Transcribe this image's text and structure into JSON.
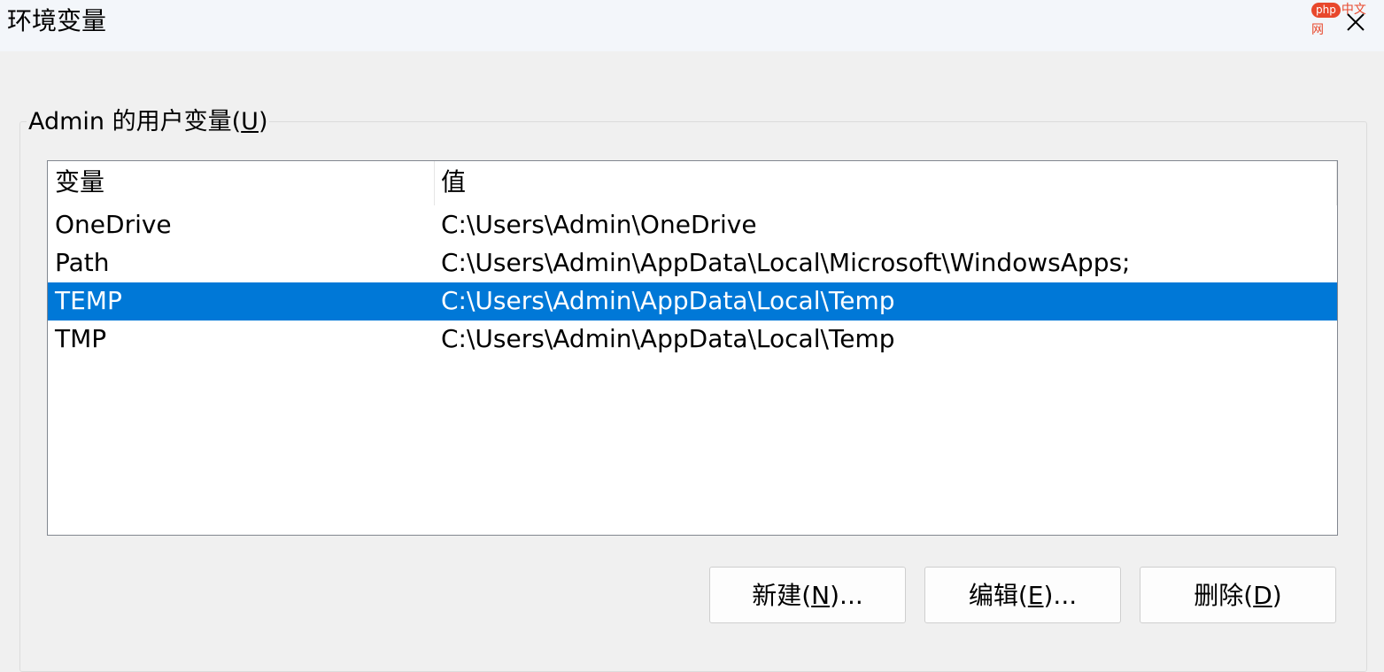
{
  "window": {
    "title": "环境变量"
  },
  "watermark": {
    "logo": "php",
    "text": "中文网"
  },
  "user_vars": {
    "group_label_prefix": "Admin 的用户变量(",
    "group_label_mnemonic": "U",
    "group_label_suffix": ")",
    "columns": [
      "变量",
      "值"
    ],
    "rows": [
      {
        "name": "OneDrive",
        "value": "C:\\Users\\Admin\\OneDrive",
        "selected": false
      },
      {
        "name": "Path",
        "value": "C:\\Users\\Admin\\AppData\\Local\\Microsoft\\WindowsApps;",
        "selected": false
      },
      {
        "name": "TEMP",
        "value": "C:\\Users\\Admin\\AppData\\Local\\Temp",
        "selected": true
      },
      {
        "name": "TMP",
        "value": "C:\\Users\\Admin\\AppData\\Local\\Temp",
        "selected": false
      }
    ],
    "selection_color": "#0078d7"
  },
  "buttons": {
    "new": {
      "prefix": "新建(",
      "mnemonic": "N",
      "suffix": ")..."
    },
    "edit": {
      "prefix": "编辑(",
      "mnemonic": "E",
      "suffix": ")..."
    },
    "delete": {
      "prefix": "删除(",
      "mnemonic": "D",
      "suffix": ")"
    }
  },
  "icons": {
    "close": "close-icon"
  }
}
